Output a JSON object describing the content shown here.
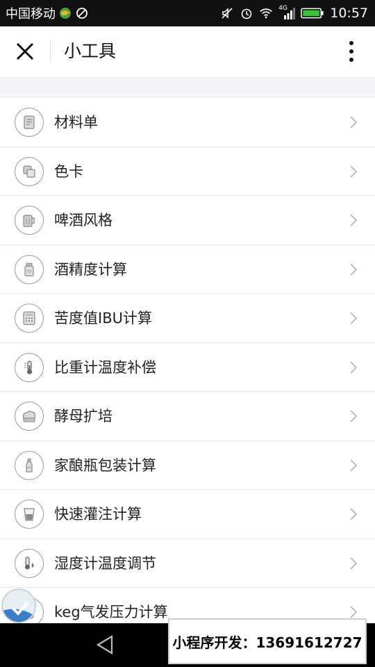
{
  "status_bar": {
    "carrier": "中国移动",
    "network": "4G",
    "time": "10:57"
  },
  "header": {
    "title": "小工具"
  },
  "tools": [
    {
      "label": "材料单",
      "icon": "document-icon"
    },
    {
      "label": "色卡",
      "icon": "color-swatch-icon"
    },
    {
      "label": "啤酒风格",
      "icon": "beer-mug-icon"
    },
    {
      "label": "酒精度计算",
      "icon": "bottle-icon"
    },
    {
      "label": "苦度值IBU计算",
      "icon": "calculator-icon"
    },
    {
      "label": "比重计温度补偿",
      "icon": "thermometer-icon"
    },
    {
      "label": "酵母扩培",
      "icon": "yeast-icon"
    },
    {
      "label": "家酿瓶包装计算",
      "icon": "small-bottle-icon"
    },
    {
      "label": "快速灌注计算",
      "icon": "glass-icon"
    },
    {
      "label": "湿度计温度调节",
      "icon": "humidity-thermometer-icon"
    },
    {
      "label": "keg气发压力计算",
      "icon": "keg-icon"
    }
  ],
  "promo": {
    "text": "小程序开发：13691612727"
  },
  "colors": {
    "status_bar_bg": "#111111",
    "header_bg": "#ffffff",
    "list_divider": "#e6e6e6",
    "icon_stroke": "#9a9a9a",
    "chevron": "#bbbbbb"
  }
}
